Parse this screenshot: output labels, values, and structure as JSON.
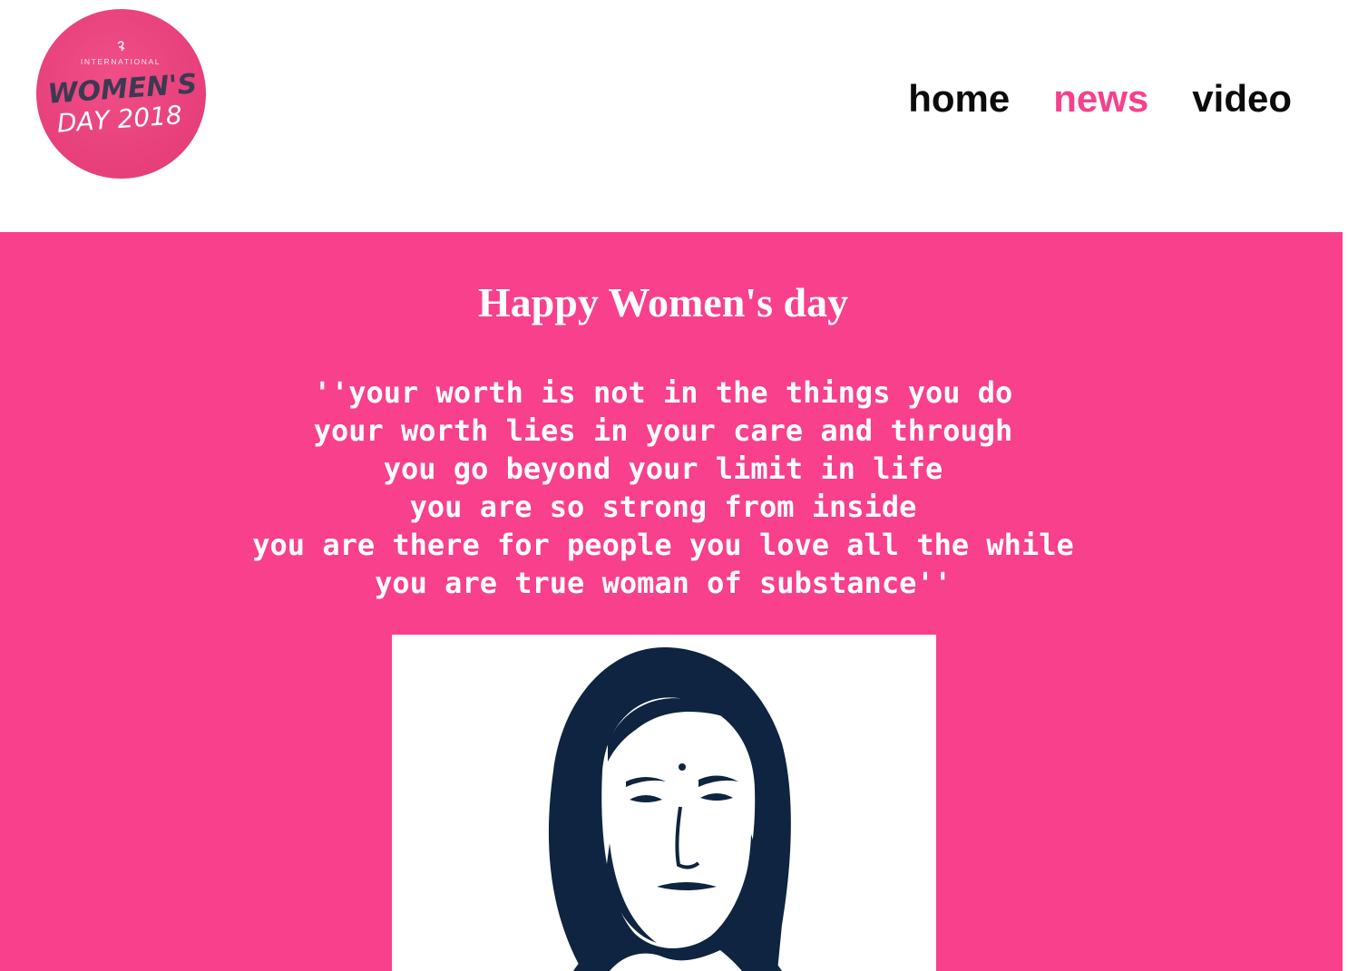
{
  "logo": {
    "line1": "INTERNATIONAL",
    "line2": "WOMEN'S",
    "line3": "DAY 2018"
  },
  "nav": {
    "items": [
      {
        "label": "home",
        "active": false
      },
      {
        "label": "news",
        "active": true
      },
      {
        "label": "video",
        "active": false
      }
    ]
  },
  "main": {
    "title": "Happy Women's day",
    "poem": [
      "''your worth is not in the things you do",
      "your worth lies in your care and through",
      "you go beyond your limit in life",
      "you are so strong from inside",
      "you are there for people you love all the while",
      "you are true woman of substance''"
    ]
  },
  "colors": {
    "accent": "#f8408c",
    "nav_active": "#f7408b",
    "logo_bg": "#e8417c",
    "portrait_ink": "#0e2440"
  }
}
